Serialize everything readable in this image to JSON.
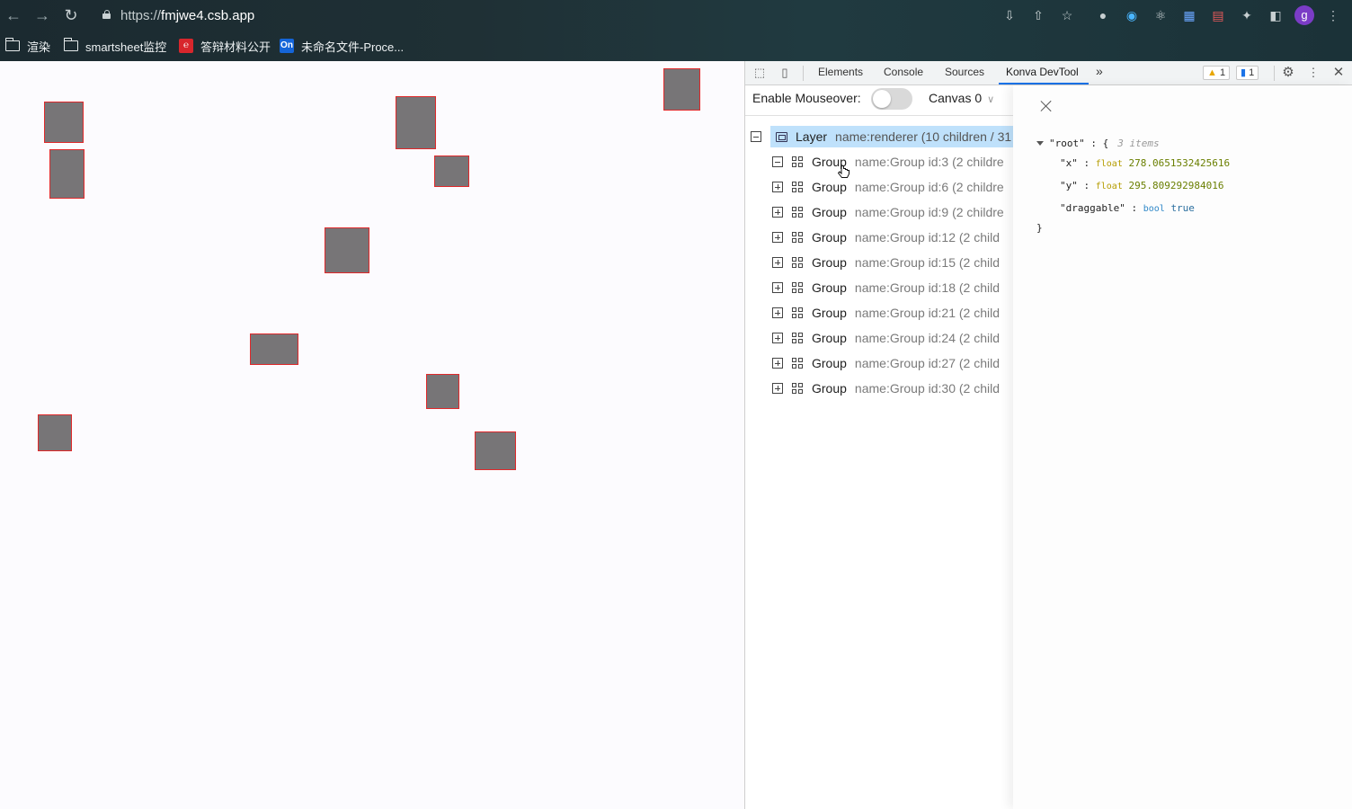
{
  "browser": {
    "url_prefix": "https://",
    "url_domain": "fmjwe4.csb.app",
    "bookmarks": [
      {
        "label": "渲染",
        "icon": "folder-icon"
      },
      {
        "label": "smartsheet监控",
        "icon": "folder-icon"
      },
      {
        "label": "答辩材料公开",
        "icon": "red-doc-icon"
      },
      {
        "label": "未命名文件-Proce...",
        "icon": "processon-icon",
        "badge": "On"
      }
    ],
    "profile_initial": "g"
  },
  "devtools": {
    "tabs": [
      "Elements",
      "Console",
      "Sources",
      "Konva DevTool"
    ],
    "active_tab": "Konva DevTool",
    "more": "»",
    "warnings_count": "1",
    "messages_count": "1",
    "toolbar": {
      "mouseover_label": "Enable Mouseover:",
      "mouseover_enabled": false,
      "canvas_label": "Canvas 0"
    },
    "tree": {
      "layer": {
        "type": "Layer",
        "attrs": "name:renderer  (10 children / 31"
      },
      "groups": [
        {
          "type": "Group",
          "attrs": "name:Group  id:3  (2 childre",
          "expanded": true
        },
        {
          "type": "Group",
          "attrs": "name:Group  id:6  (2 childre",
          "expanded": false
        },
        {
          "type": "Group",
          "attrs": "name:Group  id:9  (2 childre",
          "expanded": false
        },
        {
          "type": "Group",
          "attrs": "name:Group  id:12  (2 child",
          "expanded": false
        },
        {
          "type": "Group",
          "attrs": "name:Group  id:15  (2 child",
          "expanded": false
        },
        {
          "type": "Group",
          "attrs": "name:Group  id:18  (2 child",
          "expanded": false
        },
        {
          "type": "Group",
          "attrs": "name:Group  id:21  (2 child",
          "expanded": false
        },
        {
          "type": "Group",
          "attrs": "name:Group  id:24  (2 child",
          "expanded": false
        },
        {
          "type": "Group",
          "attrs": "name:Group  id:27  (2 child",
          "expanded": false
        },
        {
          "type": "Group",
          "attrs": "name:Group  id:30  (2 child",
          "expanded": false
        }
      ]
    },
    "inspector": {
      "root_key": "\"root\" : {",
      "root_count": "3 items",
      "props": [
        {
          "key": "\"x\" :",
          "type": "float",
          "value": "278.0651532425616"
        },
        {
          "key": "\"y\" :",
          "type": "float",
          "value": "295.809292984016"
        },
        {
          "key": "\"draggable\" :",
          "type": "bool",
          "value": "true"
        }
      ],
      "close_brace": "}"
    }
  },
  "colors": {
    "rect_fill": "#777577",
    "rect_stroke": "#e0282a",
    "selection": "#bfe1fb",
    "devtools_accent": "#1a73e8"
  }
}
